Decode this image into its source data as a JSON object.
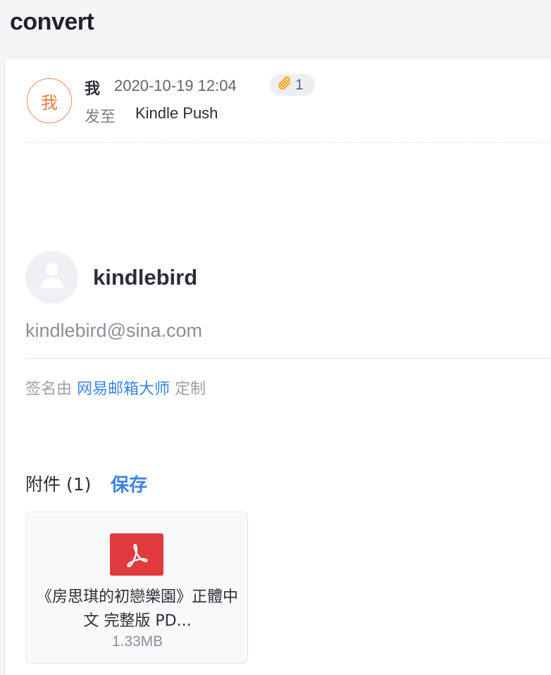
{
  "mail": {
    "subject": "convert",
    "sender": {
      "avatar_text": "我",
      "name": "我",
      "time": "2020-10-19 12:04"
    },
    "attachment_badge": {
      "icon": "paperclip-icon",
      "count": "1"
    },
    "recipient": {
      "label": "发至",
      "name": "Kindle Push"
    }
  },
  "signature": {
    "avatar_icon": "user-silhouette-icon",
    "name": "kindlebird",
    "email": "kindlebird@sina.com",
    "custom_prefix": "签名由",
    "custom_link": "网易邮箱大师",
    "custom_suffix": "定制"
  },
  "attachments": {
    "title": "附件 (1)",
    "save_label": "保存",
    "files": [
      {
        "icon": "pdf-icon",
        "name": "《房思琪的初戀樂園》正體中文 完整版 PD...",
        "size": "1.33MB"
      }
    ]
  },
  "colors": {
    "accent": "#3b83e8",
    "sender_avatar": "#f07a43",
    "paperclip": "#f5a623",
    "pdf": "#e0393e"
  }
}
